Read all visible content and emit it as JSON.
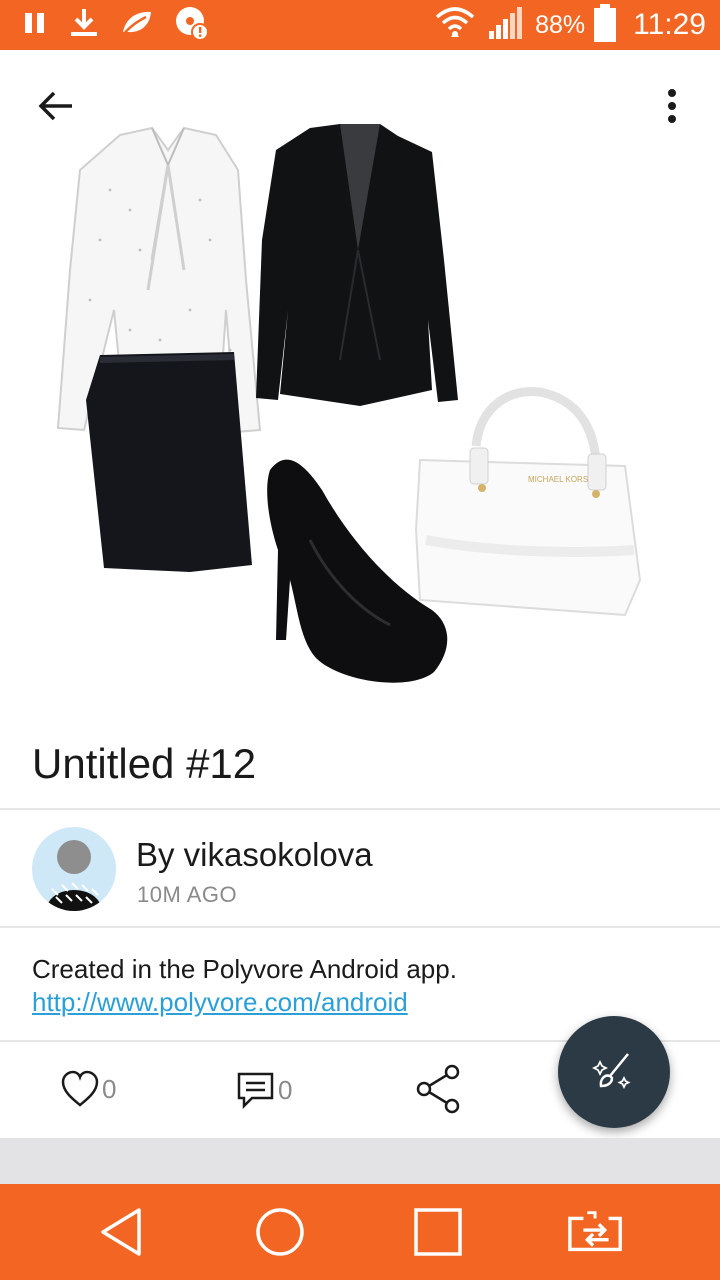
{
  "status_bar": {
    "battery_percent": "88%",
    "time": "11:29",
    "icons": [
      "pause-icon",
      "download-icon",
      "leaf-icon",
      "alert-disc-icon",
      "wifi-icon",
      "signal-icon",
      "battery-icon"
    ]
  },
  "toolbar": {
    "back_icon": "back-arrow-icon",
    "more_icon": "more-vert-icon"
  },
  "set": {
    "title": "Untitled #12",
    "author": "By vikasokolova",
    "posted": "10M AGO",
    "description_text": "Created in the Polyvore Android app. ",
    "description_link": "http://www.polyvore.com/android",
    "handbag_brand": "MICHAEL KORS"
  },
  "actions": {
    "likes": "0",
    "comments": "0",
    "like_icon": "heart-icon",
    "comment_icon": "comment-icon",
    "share_icon": "share-icon",
    "fab_icon": "magic-brush-icon"
  },
  "nav_bar": {
    "icons": [
      "back-triangle-icon",
      "home-circle-icon",
      "recents-square-icon",
      "switch-icon"
    ]
  },
  "colors": {
    "accent": "#f26522",
    "fab": "#2b3a45",
    "link": "#2a9fd8"
  }
}
